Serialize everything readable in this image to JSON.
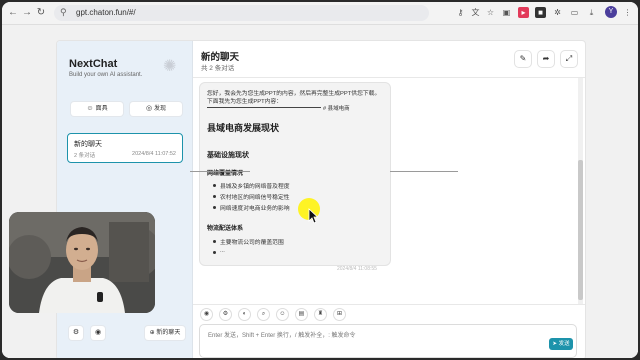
{
  "browser": {
    "url": "gpt.chaton.fun/#/",
    "profile_initial": "Y"
  },
  "sidebar": {
    "brand_title": "NextChat",
    "brand_subtitle": "Build your own AI assistant.",
    "mask_label": "面具",
    "discover_label": "发现",
    "chat_item": {
      "title": "新的聊天",
      "count": "2 条对话",
      "time": "2024/8/4 11:07:52"
    },
    "new_chat_label": "新的聊天"
  },
  "header": {
    "title": "新的聊天",
    "subtitle": "共 2 条对话"
  },
  "message": {
    "line1": "您好，我会先为您生成PPT的内容，然后再完整生成PPT供您下载。",
    "line2": "下面我先为您生成PPT内容：",
    "rule_label": "# 县域电商",
    "h1": "县域电商发展现状",
    "h2": "基础设施现状",
    "section1": "网络覆盖情况",
    "bullets1": [
      "县城及乡镇的网络普及程度",
      "农村地区的网络信号稳定性",
      "网络速度对电商业务的影响"
    ],
    "section2": "物流配送体系",
    "bullets2": [
      "主要物流公司的覆盖范围",
      "..."
    ],
    "time": "2024/8/4 11:08:55"
  },
  "input": {
    "placeholder": "Enter 发送，Shift + Enter 换行，/ 触发补全，: 触发命令",
    "send_label": "发送"
  },
  "colors": {
    "accent": "#1d93ab",
    "sidebar_bg": "#e8f0f8",
    "cursor_highlight": "#fff200"
  }
}
